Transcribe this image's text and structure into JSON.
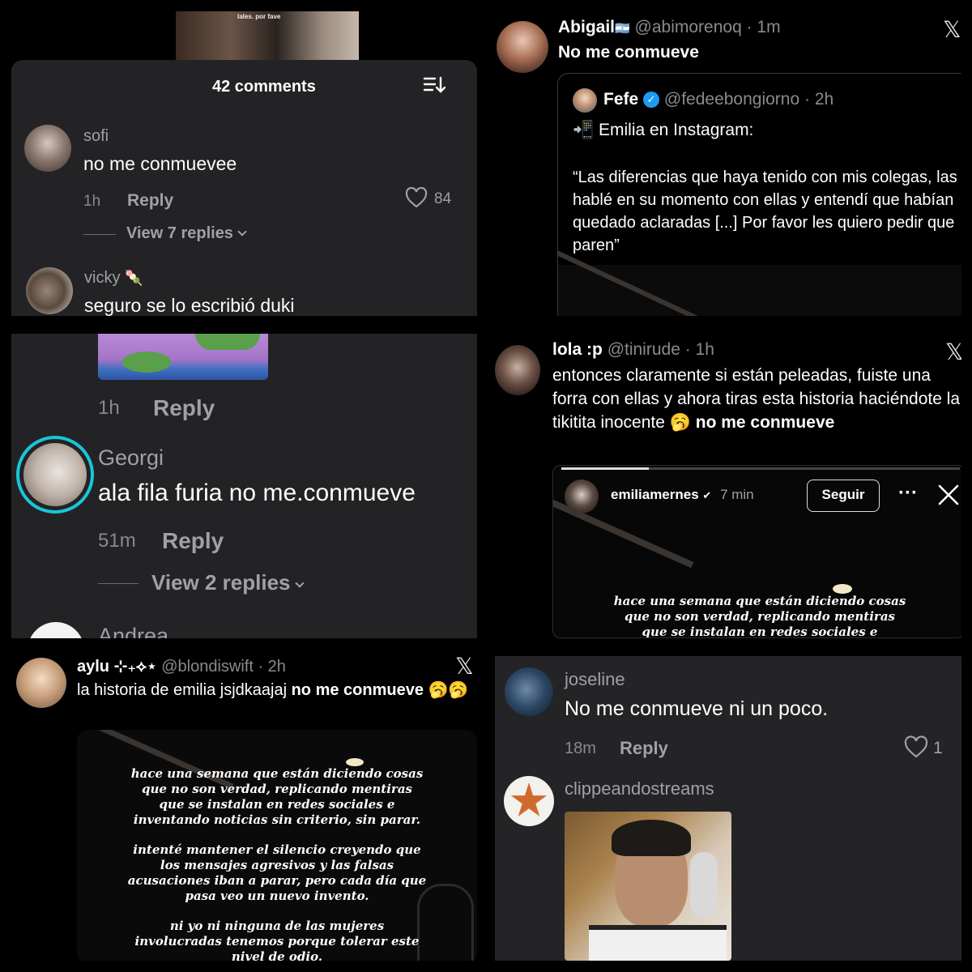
{
  "panel1": {
    "comment_count": "42 comments",
    "comments": [
      {
        "user": "sofi",
        "text": "no me conmuevee",
        "time": "1h",
        "reply": "Reply",
        "likes": "84",
        "view_replies": "View 7 replies"
      },
      {
        "user": "vicky",
        "user_emoji": "🍡",
        "text": "seguro se lo escribió duki"
      }
    ],
    "thumb_caption": "lales. por fave"
  },
  "panel2": {
    "user": "Abigail",
    "flag": "🇦🇷",
    "handle_time": "@abimorenoq · 1m",
    "text": "No me conmueve",
    "quote": {
      "user": "Fefe",
      "handle_time": "@fedeebongiorno · 2h",
      "line1": "📲 Emilia en Instagram:",
      "body": "“Las diferencias que haya tenido con mis colegas, las hablé en su momento con ellas y entendí que habían quedado aclaradas [...] Por favor les quiero pedir que paren”"
    }
  },
  "panel3": {
    "top_time": "1h",
    "top_reply": "Reply",
    "user": "Georgi",
    "text": "ala fila furia no me.conmueve",
    "time": "51m",
    "reply": "Reply",
    "view_replies": "View 2 replies",
    "next_user": "Andrea"
  },
  "panel4": {
    "user": "lola :p",
    "handle_time": "@tinirude · 1h",
    "text_plain": "entonces claramente si están peleadas, fuiste una forra con ellas y ahora tiras esta historia haciéndote la tikitita inocente 🥱",
    "text_bold": "no me conmueve",
    "story": {
      "user": "emiliamernes",
      "time": "7 min",
      "follow": "Seguir",
      "more": "···",
      "lines": [
        "hace una semana que están diciendo cosas",
        "que no son verdad, replicando mentiras",
        "que se instalan en redes sociales e"
      ]
    }
  },
  "panel5": {
    "user": "aylu ⊹₊⟡⋆",
    "handle_time": "@blondiswift · 2h",
    "text_plain": "la historia de emilia jsjdkaajaj",
    "text_bold": "no me conmueve",
    "emojis": "🥱🥱",
    "story_lines": [
      "hace una semana que están diciendo cosas",
      "que no son verdad, replicando mentiras",
      "que se instalan en redes sociales e",
      "inventando noticias sin criterio, sin parar.",
      "",
      "intenté mantener el silencio creyendo que",
      "los mensajes agresivos y las falsas",
      "acusaciones iban a parar, pero cada día que",
      "pasa veo un nuevo invento.",
      "",
      "ni yo ni ninguna de las mujeres",
      "involucradas tenemos porque tolerar este",
      "nivel de odio."
    ]
  },
  "panel6": {
    "comments": [
      {
        "user": "joseline",
        "text": "No me conmueve ni un poco.",
        "time": "18m",
        "reply": "Reply",
        "likes": "1"
      },
      {
        "user": "clippeandostreams"
      }
    ]
  },
  "colors": {
    "story_ring": "#19c6d9",
    "verified": "#1d9bf0",
    "comment_panel_bg": "#232325"
  },
  "icons": [
    "sort-icon",
    "heart-icon",
    "x-logo-icon",
    "verified-badge-icon",
    "close-icon",
    "more-icon"
  ]
}
